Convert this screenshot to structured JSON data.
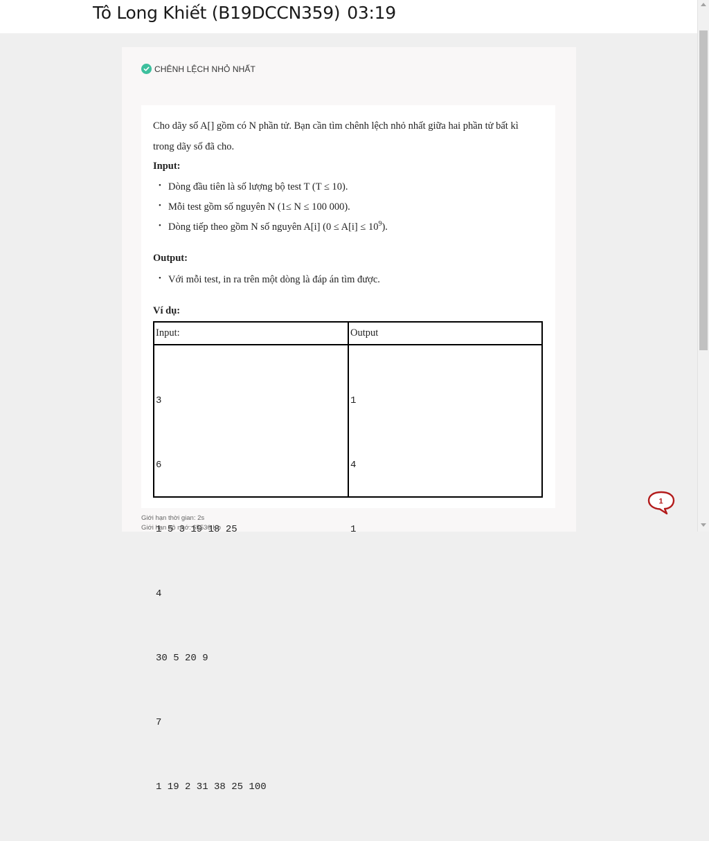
{
  "header": {
    "student": "Tô Long Khiết (B19DCCN359)",
    "time": "03:19"
  },
  "problem": {
    "name": "CHÊNH LỆCH NHỎ NHẤT",
    "status_icon": "check-circle-icon",
    "status_color": "#3dbf9d",
    "description_line1": "Cho dãy số A[] gồm có N phần tử. Bạn cần tìm chênh lệch nhỏ nhất giữa hai phần tử bất kì",
    "description_line2": "trong dãy số đã cho.",
    "input_heading": "Input:",
    "input_items": [
      "Dòng đầu tiên là số lượng bộ test T (T ≤ 10).",
      "Mỗi test gồm số nguyên N (1≤ N ≤ 100 000).",
      "Dòng tiếp theo gồm N số nguyên A[i] (0 ≤ A[i] ≤ 10",
      "9",
      ")."
    ],
    "output_heading": "Output:",
    "output_items": [
      "Với mỗi test, in ra trên một dòng là đáp án tìm được."
    ],
    "example_heading": "Ví dụ:",
    "example": {
      "headers": [
        "Input:",
        "Output"
      ],
      "input_lines": [
        "3",
        "6",
        "1 5 3 19 18 25",
        "4",
        "30 5 20 9",
        "7",
        "1 19 2 31 38 25 100"
      ],
      "output_lines": [
        "1",
        "4",
        "1"
      ]
    },
    "time_limit": "Giới hạn thời gian: 2s",
    "memory_limit": "Giới hạn bộ nhớ: 65536 Kb"
  },
  "chat": {
    "count": "1",
    "icon": "chat-bubble-icon",
    "color": "#b31b1b"
  }
}
